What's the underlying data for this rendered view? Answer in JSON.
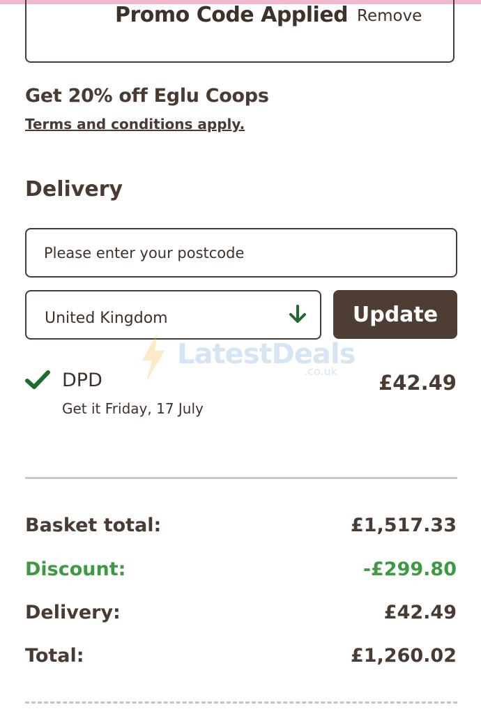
{
  "promo": {
    "title": "Promo Code Applied",
    "remove_label": "Remove"
  },
  "offer": {
    "title": "Get 20% off Eglu Coops",
    "terms_link": "Terms and conditions apply."
  },
  "delivery": {
    "heading": "Delivery",
    "postcode_placeholder": "Please enter your postcode",
    "country_value": "United Kingdom",
    "update_label": "Update"
  },
  "watermark": {
    "text": "LatestDeals",
    "sub": ".co.uk"
  },
  "option": {
    "name": "DPD",
    "date_text": "Get it Friday, 17 July",
    "price": "£42.49"
  },
  "summary": {
    "basket_label": "Basket total:",
    "basket_value": "£1,517.33",
    "discount_label": "Discount:",
    "discount_value": "-£299.80",
    "delivery_label": "Delivery:",
    "delivery_value": "£42.49",
    "total_label": "Total:",
    "total_value": "£1,260.02"
  },
  "colors": {
    "text": "#4a3b32",
    "accent_button": "#4e3d33",
    "discount": "#3d9a43",
    "check": "#1f6b2e",
    "top_strip": "#f2b6cf"
  },
  "icons": {
    "country_arrow": "arrow-down-icon",
    "selected_option": "checkmark-icon"
  }
}
